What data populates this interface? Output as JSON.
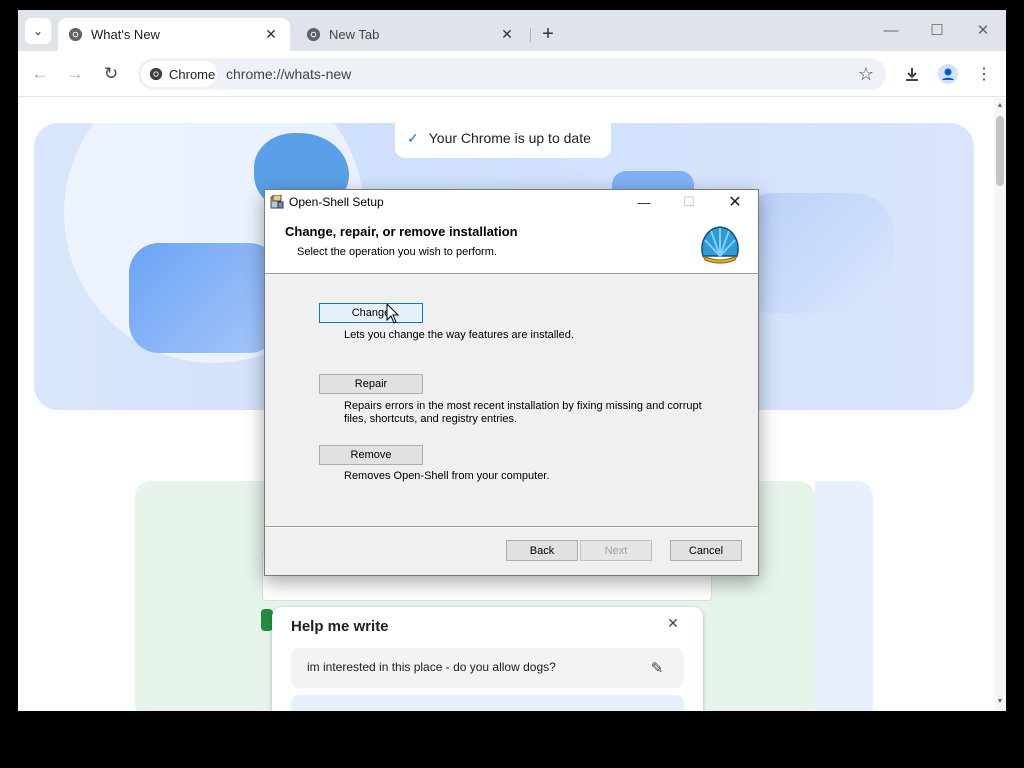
{
  "browser": {
    "tabs": [
      {
        "title": "What's New",
        "active": true
      },
      {
        "title": "New Tab",
        "active": false
      }
    ],
    "omnibox": {
      "chip_label": "Chrome",
      "url": "chrome://whats-new"
    },
    "status_banner": "Your Chrome is up to date"
  },
  "help_me_write": {
    "title": "Help me write",
    "prompt": "im interested in this place - do you allow dogs?"
  },
  "dialog": {
    "title": "Open-Shell Setup",
    "heading": "Change, repair, or remove installation",
    "subheading": "Select the operation you wish to perform.",
    "options": [
      {
        "label": "Change",
        "description": "Lets you change the way features are installed."
      },
      {
        "label": "Repair",
        "description": "Repairs errors in the most recent installation by fixing missing and corrupt files, shortcuts, and registry entries."
      },
      {
        "label": "Remove",
        "description": "Removes Open-Shell from your computer."
      }
    ],
    "buttons": {
      "back": "Back",
      "next": "Next",
      "cancel": "Cancel"
    }
  },
  "colors": {
    "accent": "#1a73e8",
    "tabstrip": "#dfe3ea",
    "dialog_bg": "#f0f0f0"
  }
}
